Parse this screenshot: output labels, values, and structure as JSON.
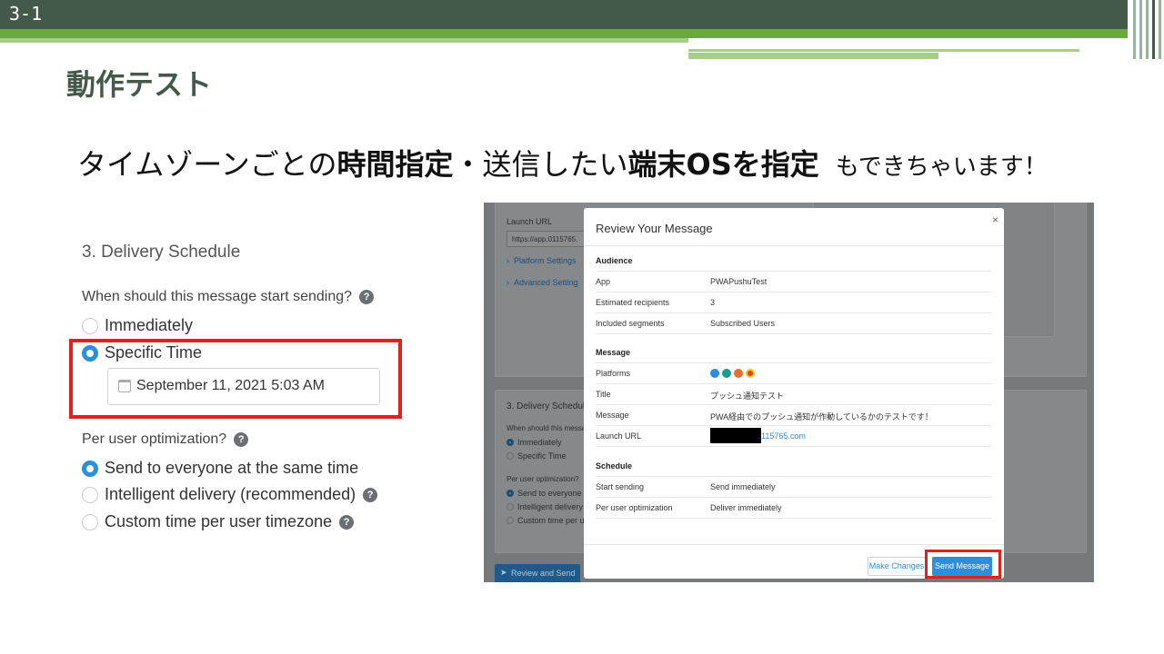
{
  "slide": {
    "number": "3-1",
    "title": "動作テスト",
    "headline": {
      "part1": "タイムゾーンごとの",
      "bold1": "時間指定",
      "part2": "・送信したい",
      "bold2": "端末OSを指定",
      "tail": "もできちゃいます！"
    }
  },
  "delivery": {
    "section_title": "3. Delivery Schedule",
    "start_question": "When should this message start sending?",
    "start_options": [
      {
        "label": "Immediately",
        "selected": false
      },
      {
        "label": "Specific Time",
        "selected": true
      }
    ],
    "date_value": "September 11, 2021 5:03 AM",
    "opt_question": "Per user optimization?",
    "opt_options": [
      {
        "label": "Send to everyone at the same time",
        "selected": true
      },
      {
        "label": "Intelligent delivery (recommended)",
        "selected": false
      },
      {
        "label": "Custom time per user timezone",
        "selected": false
      }
    ],
    "help_glyph": "?"
  },
  "screenshot": {
    "background": {
      "launch_url_label": "Launch URL",
      "launch_url_value": "https://app.0115765.",
      "platform_settings": "Platform Settings",
      "advanced_settings": "Advanced Setting",
      "section_title": "3. Delivery Schedul",
      "start_question": "When should this messa",
      "immediately": "Immediately",
      "specific_time": "Specific Time",
      "opt_question": "Per user optimization?",
      "send_everyone": "Send to everyone",
      "intelligent": "Intelligent delivery",
      "custom_time": "Custom time per u",
      "review_button": "Review and Send"
    },
    "modal": {
      "title": "Review Your Message",
      "close": "×",
      "audience": {
        "heading": "Audience",
        "rows": [
          {
            "key": "App",
            "value": "PWAPushuTest"
          },
          {
            "key": "Estimated recipients",
            "value": "3"
          },
          {
            "key": "Included segments",
            "value": "Subscribed Users"
          }
        ]
      },
      "message": {
        "heading": "Message",
        "platforms_label": "Platforms",
        "title_label": "Title",
        "title_value": "プッシュ通知テスト",
        "message_label": "Message",
        "message_value": "PWA経由でのプッシュ通知が作動しているかのテストです！",
        "url_label": "Launch URL",
        "url_value": "115765.com"
      },
      "schedule": {
        "heading": "Schedule",
        "rows": [
          {
            "key": "Start sending",
            "value": "Send immediately"
          },
          {
            "key": "Per user optimization",
            "value": "Deliver immediately"
          }
        ]
      },
      "make_changes": "Make Changes",
      "send_message": "Send Message"
    }
  },
  "colors": {
    "header_dark": "#45594b",
    "accent_green": "#6aaa3a",
    "radio_blue": "#2b8fe0",
    "highlight_red": "#e0221e"
  },
  "icons": {
    "calendar": "calendar-icon",
    "help": "help-icon",
    "chevron": "chevron-right-icon",
    "send": "send-icon",
    "close": "close-icon"
  }
}
